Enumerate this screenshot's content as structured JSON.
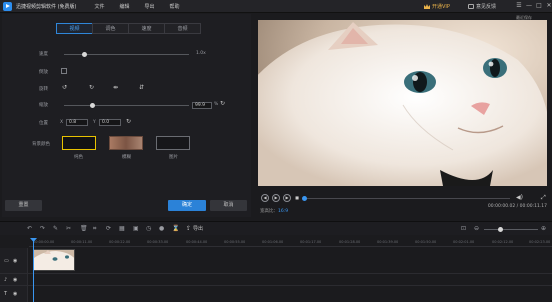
{
  "window": {
    "title": "迅捷视频剪辑软件 (免费版)",
    "menu": [
      "文件",
      "编辑",
      "导出",
      "帮助"
    ],
    "vip_label": "开通VIP",
    "feedback_label": "意见反馈",
    "controls": [
      "☰",
      "—",
      "□",
      "✕"
    ],
    "autosave": "最近保存"
  },
  "edit_panel": {
    "tabs": [
      "视频",
      "调色",
      "速度",
      "音频"
    ],
    "active_tab": 0,
    "speed": {
      "label": "速度",
      "value_label": "1.0x"
    },
    "reverse": {
      "label": "倒放"
    },
    "rotate": {
      "label": "旋转"
    },
    "scale": {
      "label": "缩放",
      "value": "99.9",
      "unit": "%"
    },
    "position": {
      "label": "位置",
      "x_label": "X",
      "x": "0.8",
      "y_label": "Y",
      "y": "0.0"
    },
    "background": {
      "label": "背景颜色",
      "options": [
        "纯色",
        "模糊",
        "图片"
      ]
    },
    "reset_label": "重置",
    "confirm_label": "确定",
    "cancel_label": "取消"
  },
  "player": {
    "ratio_label": "宽高比：",
    "ratio_value": "16:9",
    "time": "00:00:00.02 / 00:00:11.17"
  },
  "toolbar": {
    "export_label": "导出"
  },
  "timeline": {
    "ticks": [
      "00:00:00.00",
      "00:00:11.00",
      "00:00:22.00",
      "00:00:33.00",
      "00:00:44.00",
      "00:00:55.00",
      "00:01:06.00",
      "00:01:17.00",
      "00:01:28.00",
      "00:01:39.00",
      "00:01:50.00",
      "00:02:01.00",
      "00:02:12.00",
      "00:02:23.00"
    ]
  },
  "colors": {
    "accent": "#2b82d8",
    "vip": "#e9b24a",
    "swatch_solid_border": "#e8c200"
  }
}
